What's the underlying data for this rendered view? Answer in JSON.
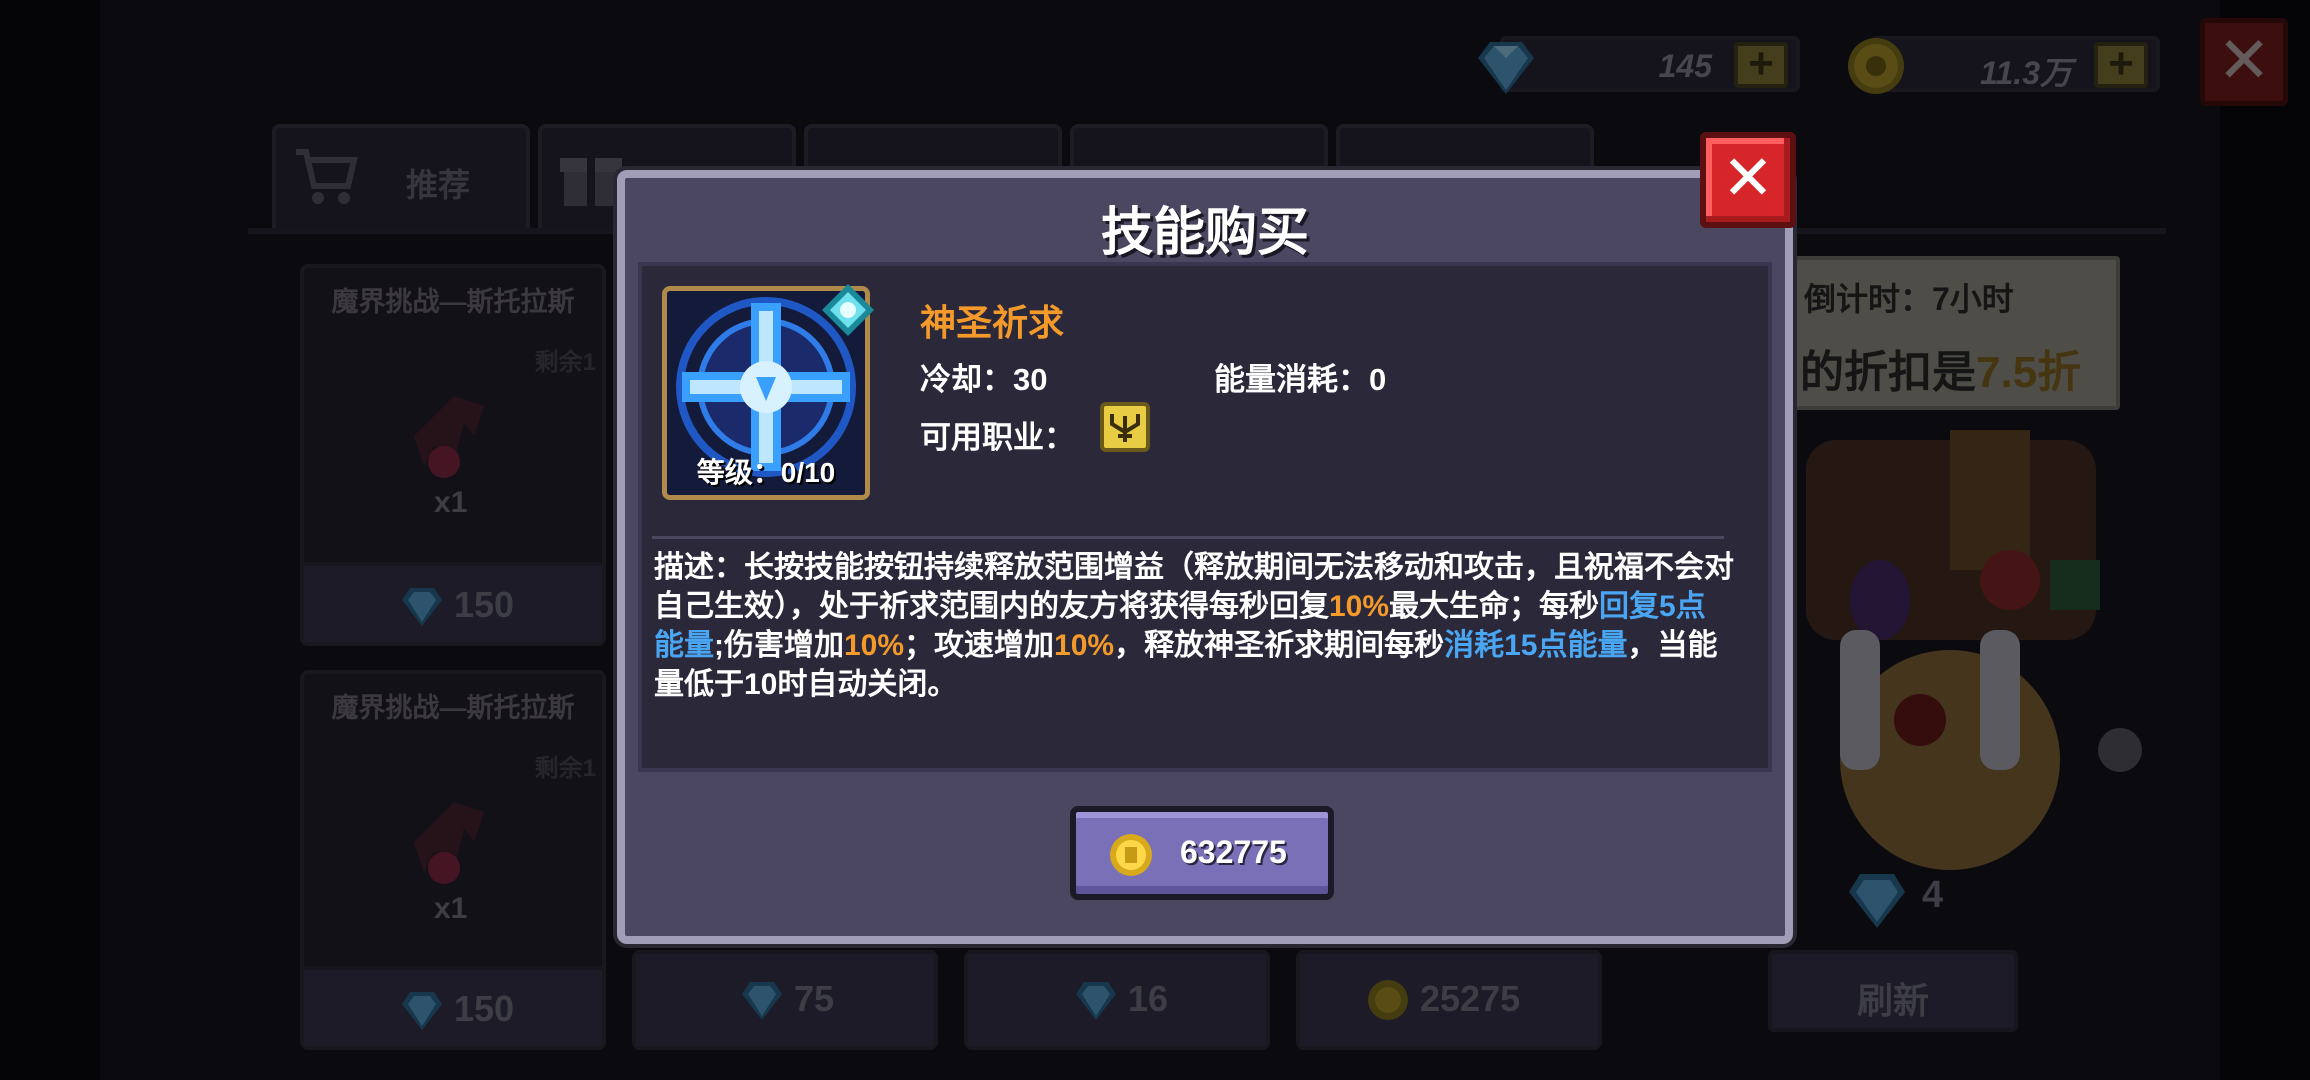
{
  "currency": {
    "gems": "145",
    "gold": "11.3万",
    "plus_label": "+"
  },
  "close_label": "✕",
  "tabs": [
    {
      "label": "推荐"
    }
  ],
  "cards": [
    {
      "title": "魔界挑战—斯托拉斯",
      "remain": "剩余1",
      "qty": "x1",
      "price": "150",
      "currency": "gem"
    },
    {
      "title": "魔界挑战—斯托拉斯",
      "remain": "剩余1",
      "qty": "x1",
      "price": "150",
      "currency": "gem"
    }
  ],
  "bottom_prices": [
    {
      "price": "75",
      "currency": "gem"
    },
    {
      "price": "16",
      "currency": "gem"
    },
    {
      "price": "25275",
      "currency": "gold"
    }
  ],
  "right_panel": {
    "timer": "倒计时：7小时",
    "discount_prefix": "的折扣是",
    "discount_value": "7.5折",
    "gem_count": "4",
    "refresh_label": "刷新"
  },
  "modal": {
    "title": "技能购买",
    "close_label": "✕",
    "skill_name": "神圣祈求",
    "level": "等级：0/10",
    "cooldown": "冷却：30",
    "energy_cost": "能量消耗：0",
    "class_label": "可用职业：",
    "description": {
      "p1": "描述：长按技能按钮持续释放范围增益（释放期间无法移动和攻击，且祝福不会对自己生效），处于祈求范围内的友方将获得每秒回复",
      "h1": "10%",
      "p2": "最大生命；每秒",
      "h2": "回复5点能量",
      "p3": ";伤害增加",
      "h3": "10%",
      "p4": "；攻速增加",
      "h4": "10%",
      "p5": "，释放神圣祈求期间每秒",
      "h5": "消耗15点能量",
      "p6": "，当能量低于10时自动关闭。"
    },
    "price": "632775"
  },
  "colors": {
    "accent_orange": "#f39a2a",
    "accent_blue": "#4aa6f2",
    "close_red": "#d6262a",
    "buy_purple": "#7a70b8"
  },
  "icons": {
    "gem": "gem-icon",
    "gold": "gold-coin-icon",
    "cart": "shopping-cart-icon",
    "gift": "gift-icon",
    "class": "priest-class-icon"
  }
}
